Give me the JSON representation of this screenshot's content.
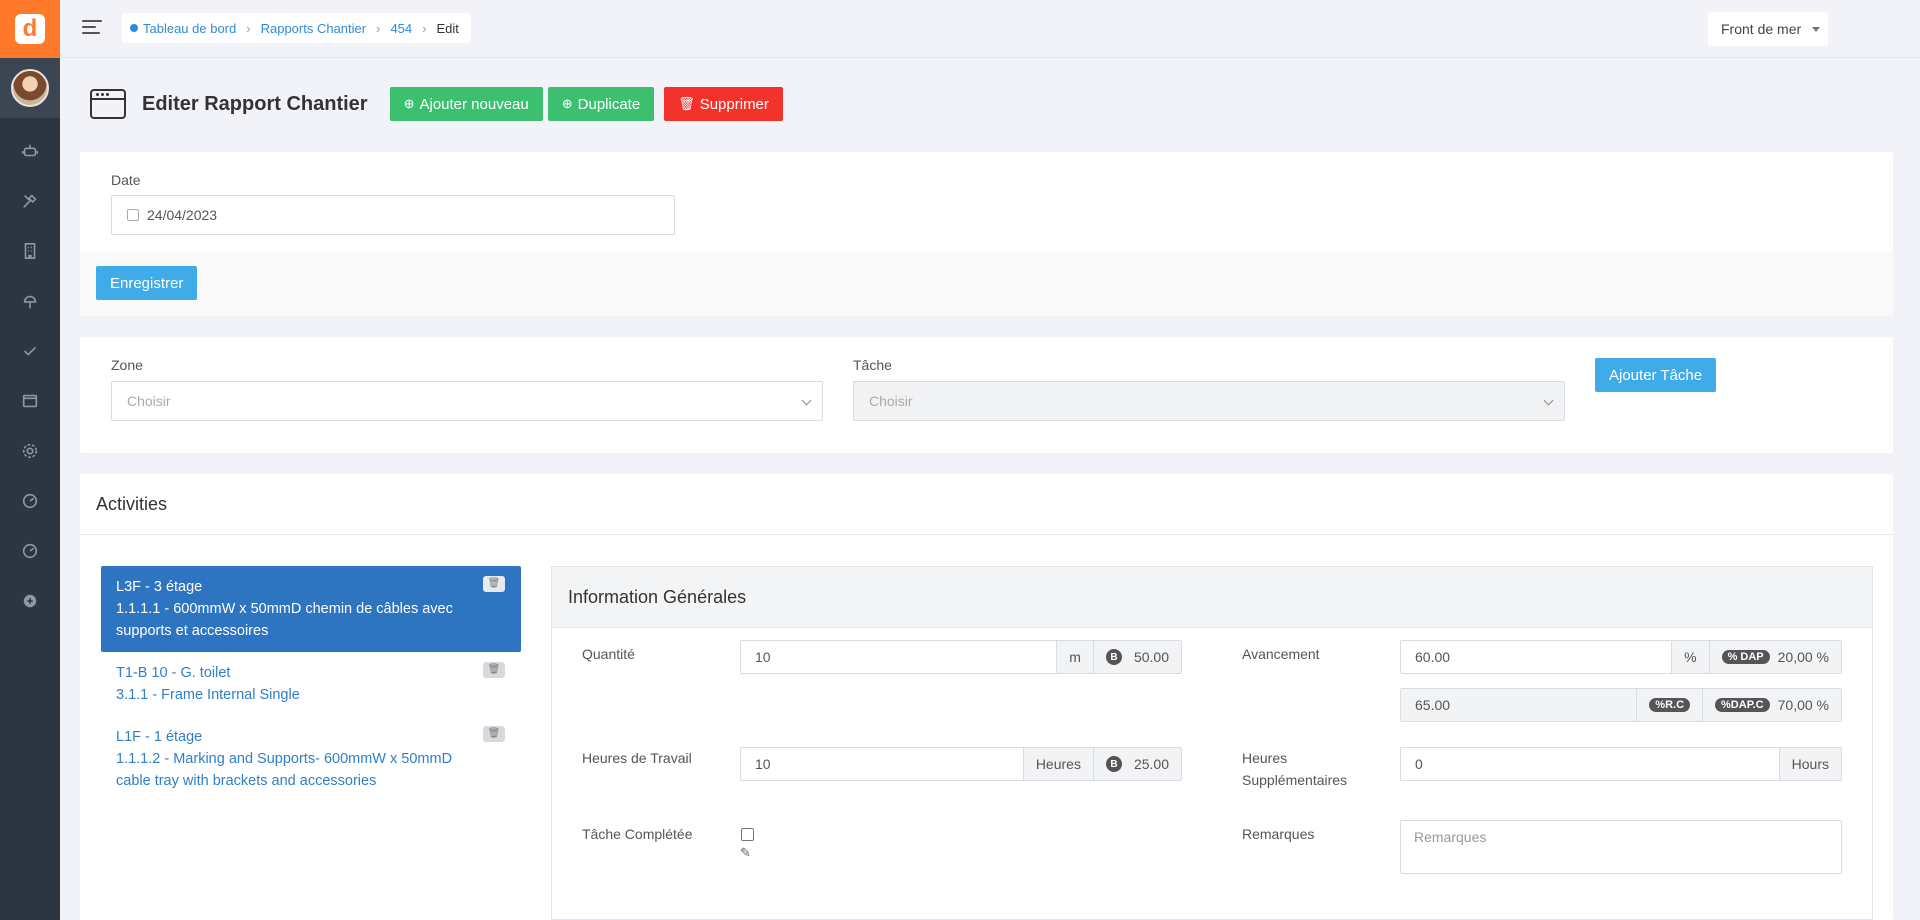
{
  "app": {
    "logo_letter": "d"
  },
  "breadcrumb": {
    "items": [
      {
        "label": "Tableau de bord"
      },
      {
        "label": "Rapports Chantier"
      },
      {
        "label": "454"
      },
      {
        "label": "Edit"
      }
    ]
  },
  "topbar": {
    "project": "Front de mer"
  },
  "sidebar": {
    "icons": [
      "robot-icon",
      "tools-icon",
      "building-icon",
      "tree-icon",
      "check-icon",
      "window-icon",
      "gear-icon",
      "dashboard-icon",
      "dashboard-alt-icon",
      "plus-circle-icon"
    ]
  },
  "header": {
    "title": "Editer Rapport Chantier",
    "add_label": "Ajouter nouveau",
    "duplicate_label": "Duplicate",
    "delete_label": "Supprimer"
  },
  "report_form": {
    "date_label": "Date",
    "date_value": "24/04/2023",
    "save_label": "Enregistrer"
  },
  "task_picker": {
    "zone_label": "Zone",
    "zone_placeholder": "Choisir",
    "task_label": "Tâche",
    "task_placeholder": "Choisir",
    "add_task_label": "Ajouter Tâche"
  },
  "activities": {
    "title": "Activities",
    "items": [
      {
        "zone": "L3F - 3 étage",
        "task": "1.1.1.1 - 600mmW x 50mmD chemin de câbles avec supports et accessoires",
        "active": true
      },
      {
        "zone": "T1-B 10 - G. toilet",
        "task": "3.1.1 - Frame Internal Single",
        "active": false
      },
      {
        "zone": "L1F - 1 étage",
        "task": "1.1.1.2 - Marking and Supports- 600mmW x 50mmD cable tray with brackets and accessories",
        "active": false
      }
    ]
  },
  "info": {
    "title": "Information Générales",
    "quantite_label": "Quantité",
    "quantite_value": "10",
    "quantite_unit": "m",
    "quantite_budget": "50.00",
    "badge_b": "B",
    "avancement_label": "Avancement",
    "avancement_value": "60.00",
    "avancement_unit": "%",
    "dap_badge": "% DAP",
    "dap_value": "20,00 %",
    "rc_value": "65.00",
    "rc_badge": "%R.C",
    "dapc_badge": "%DAP.C",
    "dapc_value": "70,00 %",
    "heures_label": "Heures de Travail",
    "heures_value": "10",
    "heures_unit": "Heures",
    "heures_budget": "25.00",
    "supp_label": "Heures Supplémentaires",
    "supp_value": "0",
    "supp_unit": "Hours",
    "complete_label": "Tâche Complétée",
    "remarques_label": "Remarques",
    "remarques_placeholder": "Remarques"
  }
}
